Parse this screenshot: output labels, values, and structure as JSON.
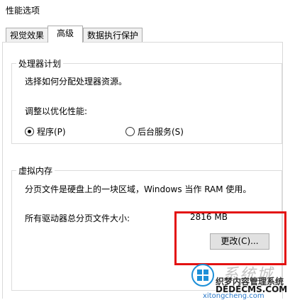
{
  "window": {
    "title": "性能选项"
  },
  "tabs": [
    {
      "label": "视觉效果",
      "active": false
    },
    {
      "label": "高级",
      "active": true
    },
    {
      "label": "数据执行保护",
      "active": false
    }
  ],
  "processor_scheduling": {
    "group_label": "处理器计划",
    "description": "选择如何分配处理器资源。",
    "optimize_label": "调整以优化性能:",
    "options": [
      {
        "label": "程序(P)",
        "selected": true
      },
      {
        "label": "后台服务(S)",
        "selected": false
      }
    ]
  },
  "virtual_memory": {
    "group_label": "虚拟内存",
    "description": "分页文件是硬盘上的一块区域，Windows 当作 RAM 使用。",
    "total_label": "所有驱动器总分页文件大小:",
    "total_value": "2816 MB",
    "change_button": "更改(C)..."
  },
  "watermark": {
    "brand": "系统城",
    "cms": "织梦内容管理系统",
    "domain": "DEDECMS.COM",
    "site": "xitongcheng.com"
  },
  "colors": {
    "highlight": "#e31212",
    "windows_logo": "#1e90d8"
  }
}
